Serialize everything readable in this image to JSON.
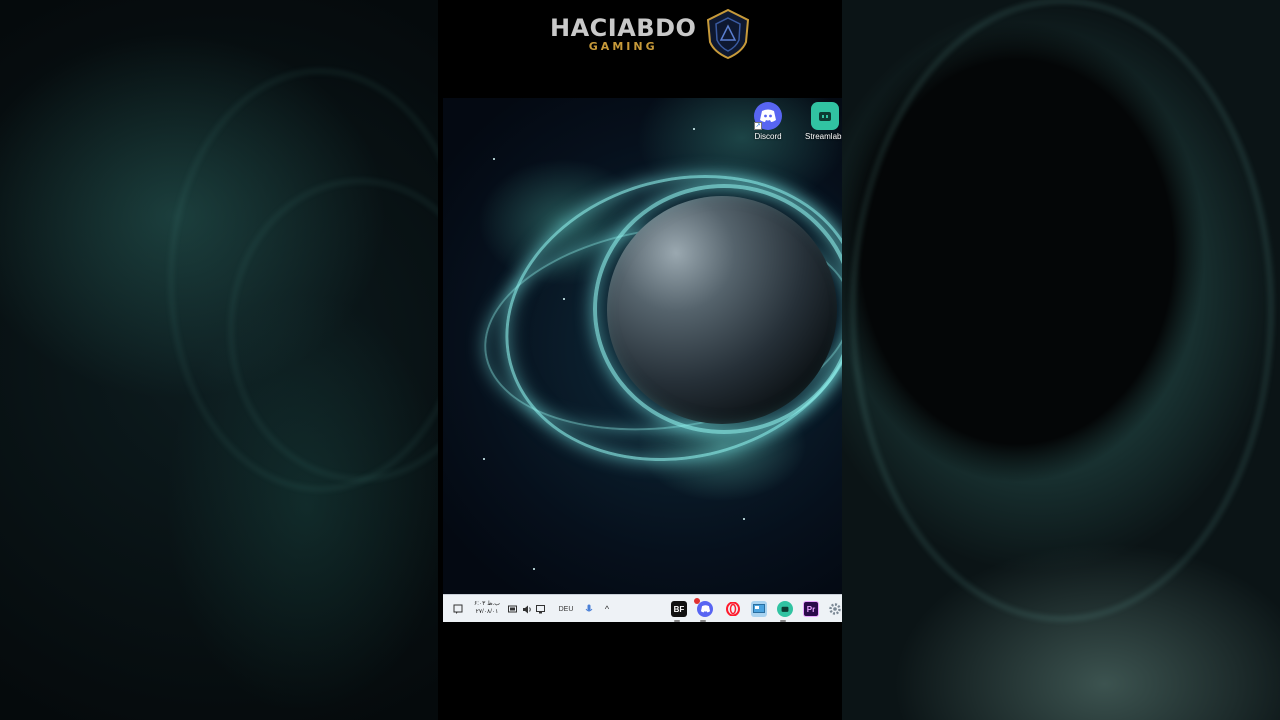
{
  "brand": {
    "title": "HACIABDO",
    "subtitle": "GAMING"
  },
  "desktop": {
    "icons": [
      {
        "name": "discord",
        "label": "Discord",
        "color": "#5865f2"
      },
      {
        "name": "streamlabs",
        "label": "Streamlabs",
        "color": "#31c3a2"
      }
    ]
  },
  "taskbar": {
    "clock_time": "۶:۰۳ ب.ظ",
    "clock_date": "۲۷/۰۸/۰۱",
    "language": "DEU",
    "tray_chevron": "^",
    "apps": [
      {
        "name": "bf",
        "label": "BF",
        "color": "#111111"
      },
      {
        "name": "discord",
        "label": "",
        "color": "#5865f2"
      },
      {
        "name": "opera",
        "label": "O",
        "color": "#ff1b2d"
      },
      {
        "name": "control-panel",
        "label": "",
        "color": "#4aa3df"
      },
      {
        "name": "streamlabs",
        "label": "",
        "color": "#31c3a2"
      },
      {
        "name": "premiere",
        "label": "Pr",
        "color": "#2a0a4a"
      },
      {
        "name": "settings",
        "label": "",
        "color": "#7a8794"
      }
    ]
  }
}
